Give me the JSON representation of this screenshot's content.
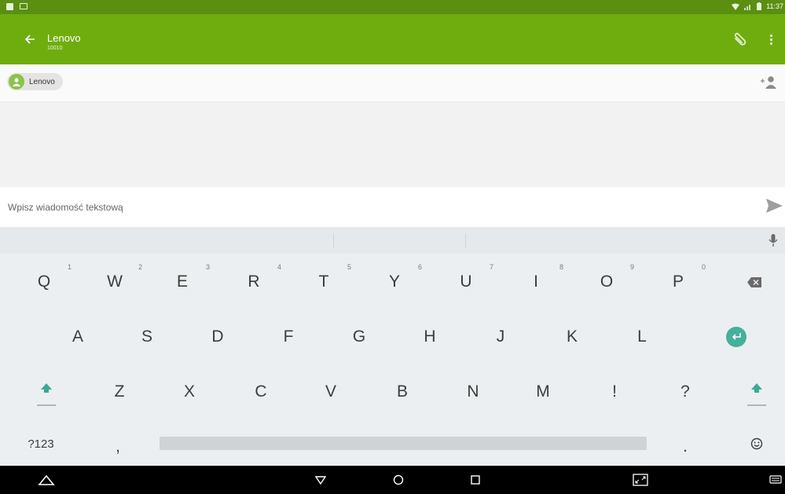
{
  "status_bar": {
    "time": "11:37",
    "icons": [
      "notification-icon",
      "image-icon",
      "wifi-icon",
      "signal-icon",
      "battery-icon"
    ]
  },
  "app_bar": {
    "title": "Lenovo",
    "subtitle": "10010",
    "background": "#6fad0f",
    "icons": [
      "back-arrow-icon",
      "paperclip-icon",
      "more-vert-icon"
    ]
  },
  "recipients": {
    "chips": [
      {
        "label": "Lenovo"
      }
    ],
    "add_icon": "add-person-icon"
  },
  "compose": {
    "placeholder": "Wpisz wiadomość tekstową",
    "value": "",
    "send_icon": "send-icon"
  },
  "keyboard": {
    "suggestions": [
      "",
      "",
      ""
    ],
    "row1": [
      {
        "label": "Q",
        "hint": "1"
      },
      {
        "label": "W",
        "hint": "2"
      },
      {
        "label": "E",
        "hint": "3"
      },
      {
        "label": "R",
        "hint": "4"
      },
      {
        "label": "T",
        "hint": "5"
      },
      {
        "label": "Y",
        "hint": "6"
      },
      {
        "label": "U",
        "hint": "7"
      },
      {
        "label": "I",
        "hint": "8"
      },
      {
        "label": "O",
        "hint": "9"
      },
      {
        "label": "P",
        "hint": "0"
      }
    ],
    "row2": [
      "A",
      "S",
      "D",
      "F",
      "G",
      "H",
      "J",
      "K",
      "L"
    ],
    "row3": [
      "Z",
      "X",
      "C",
      "V",
      "B",
      "N",
      "M",
      "!",
      "?"
    ],
    "row4": {
      "symbols": "?123",
      "comma": ",",
      "period": "."
    },
    "accent": "#45b09c"
  },
  "nav_bar": {
    "icons": [
      "hide-keyboard-icon",
      "back-icon",
      "home-icon",
      "recents-icon",
      "screenshot-icon",
      "keyboard-switch-icon"
    ]
  }
}
